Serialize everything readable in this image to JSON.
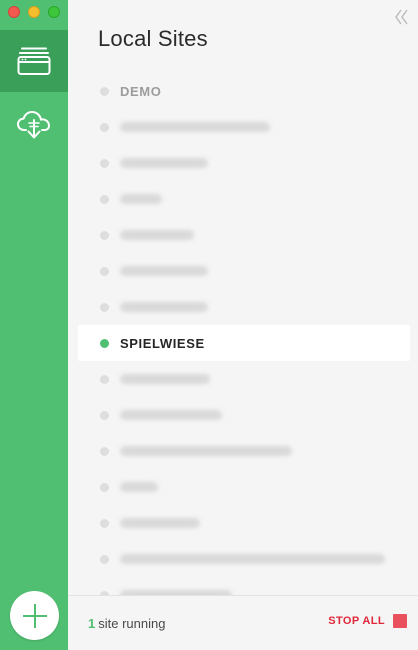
{
  "app": {
    "title": "Local Sites"
  },
  "sidebar": {
    "items": [
      {
        "name": "sites",
        "icon": "browser-window-icon",
        "active": true
      },
      {
        "name": "connect",
        "icon": "cloud-download-icon",
        "active": false
      }
    ],
    "add_icon": "plus-icon"
  },
  "sites": [
    {
      "label": "DEMO",
      "running": false,
      "blurred": false
    },
    {
      "label": "",
      "running": false,
      "blurred": true
    },
    {
      "label": "",
      "running": false,
      "blurred": true
    },
    {
      "label": "",
      "running": false,
      "blurred": true
    },
    {
      "label": "",
      "running": false,
      "blurred": true
    },
    {
      "label": "",
      "running": false,
      "blurred": true
    },
    {
      "label": "",
      "running": false,
      "blurred": true
    },
    {
      "label": "SPIELWIESE",
      "running": true,
      "blurred": false,
      "selected": true
    },
    {
      "label": "",
      "running": false,
      "blurred": true
    },
    {
      "label": "",
      "running": false,
      "blurred": true
    },
    {
      "label": "",
      "running": false,
      "blurred": true
    },
    {
      "label": "",
      "running": false,
      "blurred": true
    },
    {
      "label": "",
      "running": false,
      "blurred": true
    },
    {
      "label": "",
      "running": false,
      "blurred": true
    },
    {
      "label": "",
      "running": false,
      "blurred": true
    }
  ],
  "footer": {
    "running_count": "1",
    "running_text": "site running",
    "stop_all_label": "STOP ALL"
  },
  "colors": {
    "accent": "#51bf72",
    "sidebar_active": "#3a9f59",
    "stop": "#e0273a"
  }
}
